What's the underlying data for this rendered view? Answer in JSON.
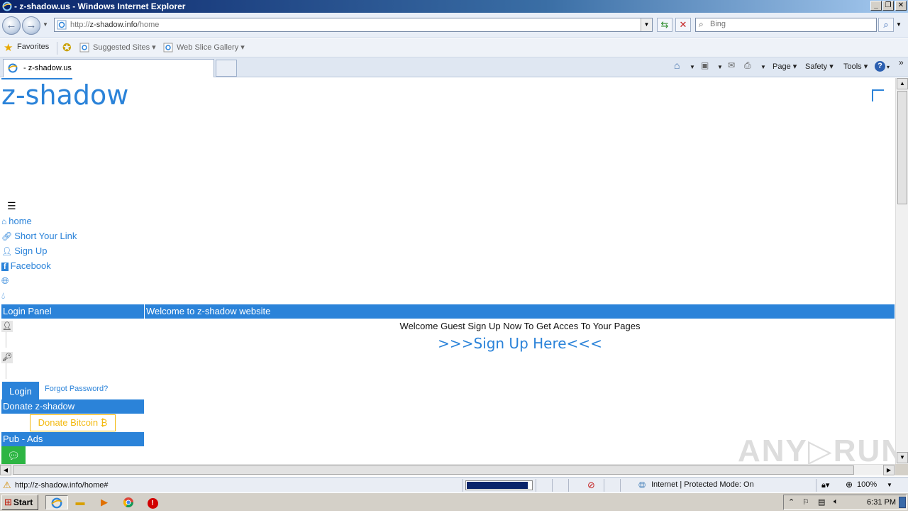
{
  "window": {
    "title": "- z-shadow.us - Windows Internet Explorer",
    "controls": {
      "minimize": "_",
      "maximize": "❐",
      "close": "✕"
    }
  },
  "navbar": {
    "address_prefix": "http://",
    "address_host": "z-shadow.info",
    "address_path": "/home",
    "search_placeholder": "Bing",
    "back_icon": "back-arrow-icon",
    "forward_icon": "forward-arrow-icon"
  },
  "favorites_bar": {
    "favorites_label": "Favorites",
    "items": [
      {
        "label": "Suggested Sites ▾"
      },
      {
        "label": "Web Slice Gallery ▾"
      }
    ]
  },
  "tabs": [
    {
      "label": "- z-shadow.us",
      "active": true
    }
  ],
  "command_bar": {
    "page_label": "Page ▾",
    "safety_label": "Safety ▾",
    "tools_label": "Tools ▾",
    "help_label": "▾",
    "more_label": "»"
  },
  "site": {
    "logo": "z-shadow",
    "menu_toggle": "☰",
    "menu": [
      {
        "label": "home",
        "icon": "home-icon"
      },
      {
        "label": "Short Your Link",
        "icon": "link-icon"
      },
      {
        "label": "Sign Up",
        "icon": "user-plus-icon"
      },
      {
        "label": "Facebook",
        "icon": "facebook-icon"
      }
    ],
    "login_panel_title": "Login Panel",
    "welcome_title": "Welcome to z-shadow website",
    "welcome_message": "Welcome Guest Sign Up Now To Get Acces To Your Pages",
    "signup_link": ">>>Sign Up Here<<<",
    "login_button": "Login",
    "forgot_password": "Forgot Password?",
    "donate_title": "Donate z-shadow",
    "donate_button": "Donate Bitcoin ₿",
    "ads_title": "Pub - Ads"
  },
  "statusbar": {
    "url": "http://z-shadow.info/home#",
    "zone": "Internet | Protected Mode: On",
    "zoom": "100%",
    "progress": 0.95
  },
  "taskbar": {
    "start_label": "Start",
    "clock": "6:31 PM"
  },
  "watermark": "ANY▷RUN",
  "colors": {
    "accent": "#2b83d9",
    "bitcoin": "#f3b90f",
    "green": "#2db543"
  }
}
